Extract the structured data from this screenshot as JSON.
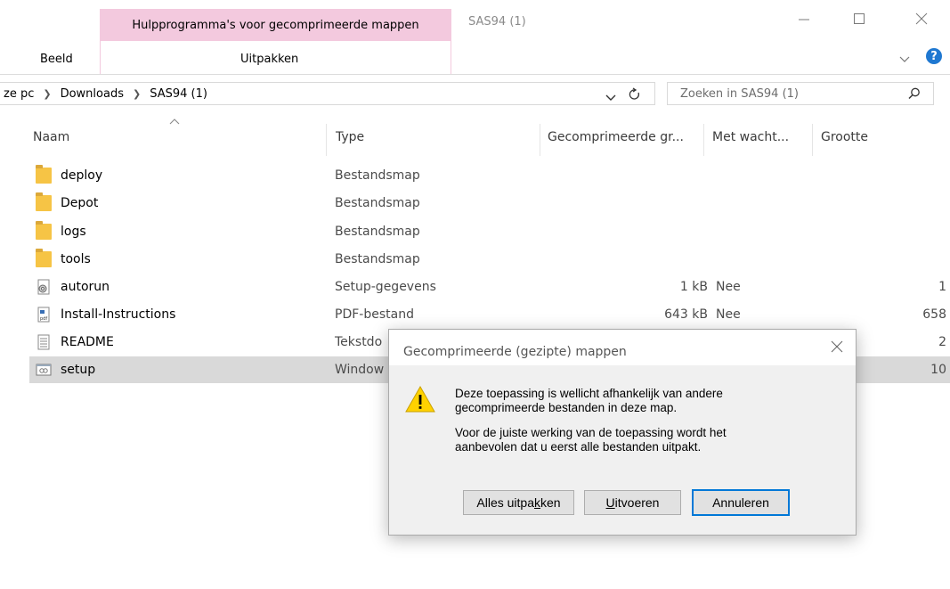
{
  "window": {
    "contextual_tab_group": "Hulpprogramma's voor gecomprimeerde mappen",
    "title": "SAS94 (1)"
  },
  "ribbon": {
    "tabs": [
      {
        "label": "Beeld"
      },
      {
        "label": "Uitpakken"
      }
    ]
  },
  "address": {
    "crumbs": [
      "ze pc",
      "Downloads",
      "SAS94 (1)"
    ],
    "search_placeholder": "Zoeken in SAS94 (1)"
  },
  "columns": {
    "name": "Naam",
    "type": "Type",
    "compressed": "Gecomprimeerde gr...",
    "password": "Met wacht...",
    "size": "Grootte"
  },
  "files": [
    {
      "name": "deploy",
      "type": "Bestandsmap",
      "compressed": "",
      "password": "",
      "size": "",
      "icon": "folder-icon"
    },
    {
      "name": "Depot",
      "type": "Bestandsmap",
      "compressed": "",
      "password": "",
      "size": "",
      "icon": "folder-icon"
    },
    {
      "name": "logs",
      "type": "Bestandsmap",
      "compressed": "",
      "password": "",
      "size": "",
      "icon": "folder-icon"
    },
    {
      "name": "tools",
      "type": "Bestandsmap",
      "compressed": "",
      "password": "",
      "size": "",
      "icon": "folder-icon"
    },
    {
      "name": "autorun",
      "type": "Setup-gegevens",
      "compressed": "1 kB",
      "password": "Nee",
      "size": "1",
      "icon": "setup-info-icon"
    },
    {
      "name": "Install-Instructions",
      "type": "PDF-bestand",
      "compressed": "643 kB",
      "password": "Nee",
      "size": "658",
      "icon": "pdf-icon"
    },
    {
      "name": "README",
      "type": "Tekstdo",
      "compressed": "",
      "password": "",
      "size": "2",
      "icon": "text-file-icon"
    },
    {
      "name": "setup",
      "type": "Window",
      "compressed": "",
      "password": "",
      "size": "10",
      "icon": "application-icon",
      "selected": true
    }
  ],
  "dialog": {
    "title": "Gecomprimeerde (gezipte) mappen",
    "message_lines": [
      "Deze toepassing is wellicht afhankelijk van andere",
      "gecomprimeerde bestanden in deze map.",
      "Voor de juiste werking van de toepassing wordt het",
      "aanbevolen dat u eerst alle bestanden uitpakt."
    ],
    "buttons": {
      "extract_all": {
        "pre": "Alles uitpa",
        "accel": "k",
        "post": "ken"
      },
      "run": {
        "pre": "",
        "accel": "U",
        "post": "itvoeren"
      },
      "cancel": "Annuleren"
    }
  },
  "colors": {
    "context_tab": "#f3c9de",
    "selection": "#d9d9d9",
    "accent": "#0078d7",
    "help": "#1f78d1",
    "warning": "#ffd200"
  }
}
